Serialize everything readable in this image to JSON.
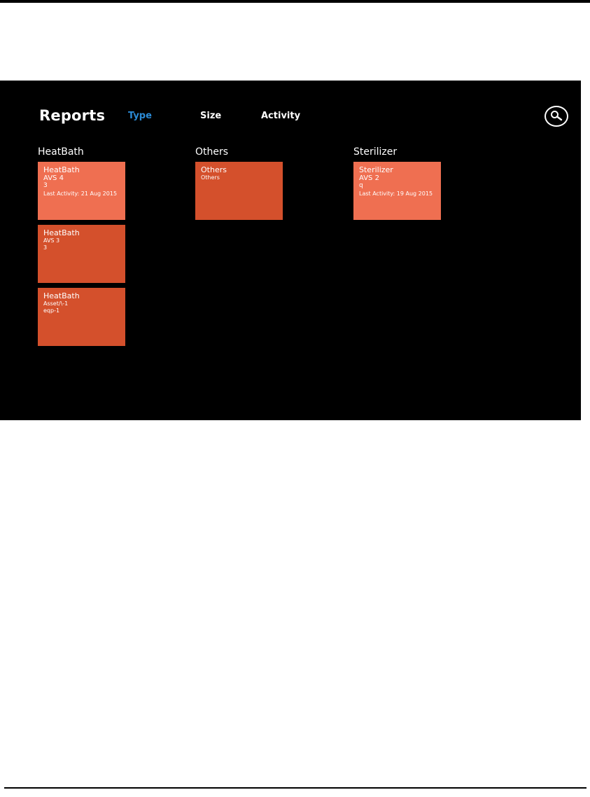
{
  "header": {
    "title": "Reports",
    "tabs": [
      {
        "label": "Type",
        "active": true
      },
      {
        "label": "Size",
        "active": false
      },
      {
        "label": "Activity",
        "active": false
      }
    ],
    "search_icon": "search-icon"
  },
  "colors": {
    "background": "#000000",
    "accent": "#2b8bd6",
    "tile_light": "#ef6f51",
    "tile_dark": "#d4502c"
  },
  "groups": [
    {
      "name": "HeatBath",
      "tiles": [
        {
          "title": "HeatBath",
          "line2": "AVS 4",
          "line3": "3",
          "line4": "Last Activity: 21 Aug 2015"
        },
        {
          "title": "HeatBath",
          "line2": "AVS 3",
          "line3": "3"
        },
        {
          "title": "HeatBath",
          "line2": "Asset/\\-1",
          "line3": "eqp-1"
        }
      ]
    },
    {
      "name": "Others",
      "tiles": [
        {
          "title": "Others",
          "line2": "Others"
        }
      ]
    },
    {
      "name": "Sterilizer",
      "tiles": [
        {
          "title": "Sterilizer",
          "line2": "AVS 2",
          "line3": "q",
          "line4": "Last Activity: 19 Aug 2015"
        }
      ]
    }
  ]
}
